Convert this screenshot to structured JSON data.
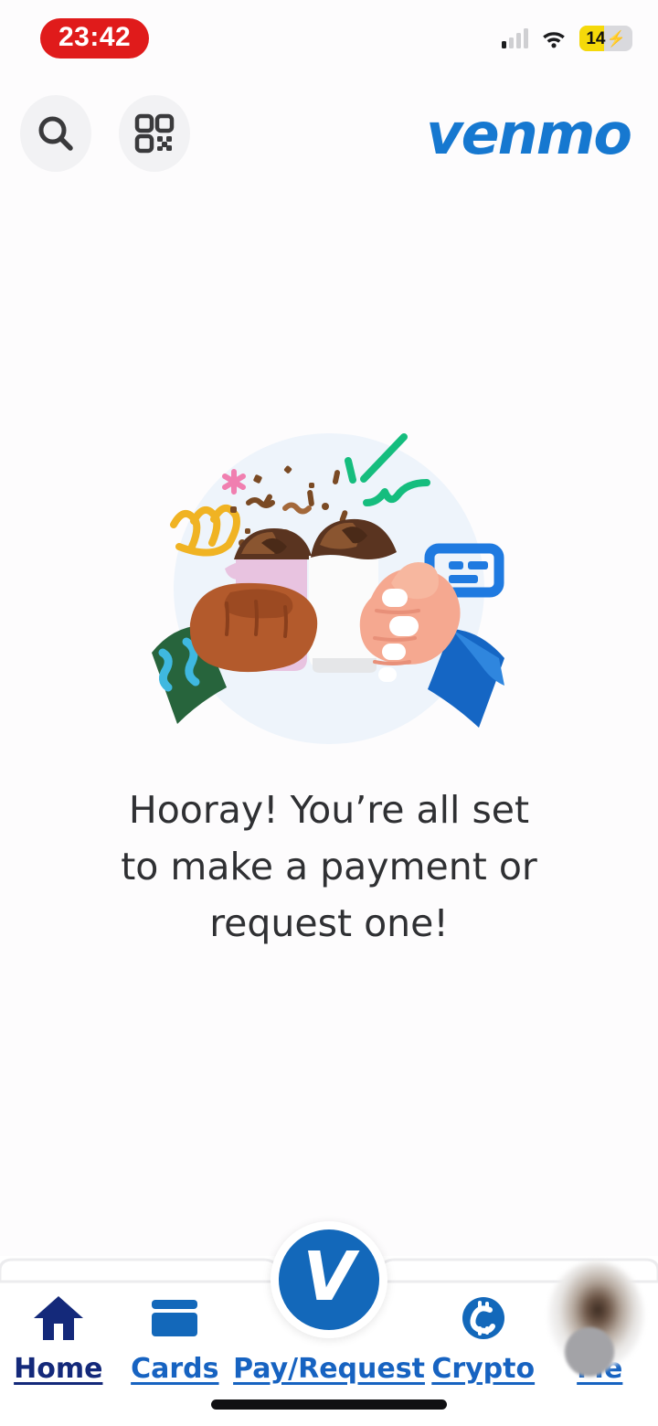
{
  "status_bar": {
    "time": "23:42",
    "time_pill_color": "#e01b1b",
    "battery_percent": "14",
    "battery_charging_glyph": "⚡",
    "battery_fill_color": "#f5d90a",
    "signal_icon": "cellular-signal-icon",
    "wifi_icon": "wifi-icon"
  },
  "header": {
    "search_icon": "search-icon",
    "qr_icon": "qr-code-icon",
    "brand": "venmo",
    "brand_color": "#1678d0"
  },
  "illustration": {
    "name": "fist-bump-coffee-cups-illustration",
    "circle_bg_color": "#eef4fb",
    "decorations": [
      "pink-asterisk",
      "yellow-squiggle",
      "green-strokes",
      "blue-speech-bubble",
      "brown-confetti"
    ]
  },
  "main": {
    "headline_line1": "Hooray! You’re all set",
    "headline_line2": "to make a payment or",
    "headline_line3": "request one!",
    "headline_color": "#2f3033"
  },
  "bottom_nav": {
    "accent_color": "#1763c1",
    "active_color": "#14297a",
    "items": [
      {
        "label": "Home",
        "icon": "home-icon"
      },
      {
        "label": "Cards",
        "icon": "credit-card-icon"
      },
      {
        "label": "Pay/Request",
        "icon": "venmo-v-icon"
      },
      {
        "label": "Crypto",
        "icon": "crypto-coin-icon"
      },
      {
        "label": "Me",
        "icon": "avatar-icon"
      }
    ],
    "fab_letter": "V",
    "fab_color": "#1368ba"
  }
}
